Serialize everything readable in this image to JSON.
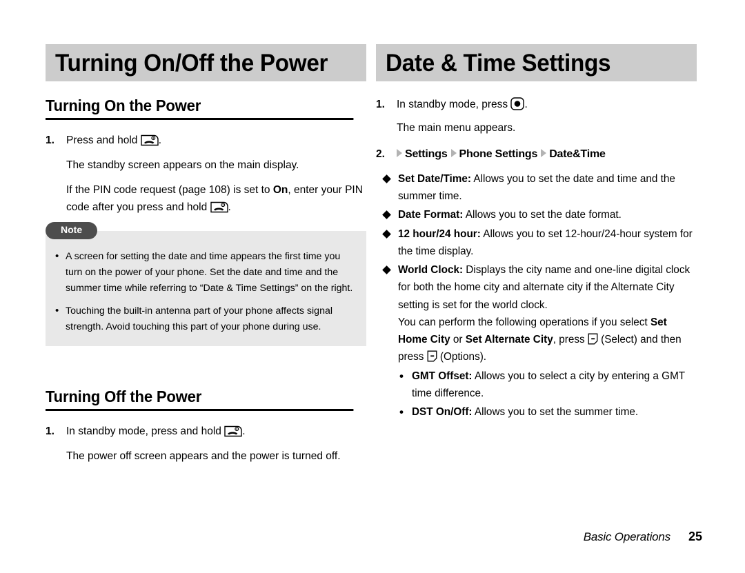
{
  "left": {
    "banner_title": "Turning On/Off the Power",
    "section1": {
      "heading": "Turning On the Power",
      "step1_num": "1.",
      "step1_text_before": "Press and hold",
      "step1_text_after": ".",
      "para1": "The standby screen appears on the main display.",
      "para2_a": "If the PIN code request (page 108) is set to ",
      "para2_bold": "On",
      "para2_b": ", enter your PIN code after you press and hold ",
      "para2_c": "."
    },
    "note": {
      "label": "Note",
      "items": [
        "A screen for setting the date and time appears the first time you turn on the power of your phone. Set the date and time and the summer time while referring to “Date & Time Settings” on the right.",
        "Touching the built-in antenna part of your phone affects signal strength. Avoid touching this part of your phone during use."
      ]
    },
    "section2": {
      "heading": "Turning Off the Power",
      "step1_num": "1.",
      "step1_text_before": "In standby mode, press and hold",
      "step1_text_after": ".",
      "para1": "The power off screen appears and the power is turned off."
    }
  },
  "right": {
    "banner_title": "Date & Time Settings",
    "step1_num": "1.",
    "step1_text_before": "In standby mode, press",
    "step1_text_after": ".",
    "step1_para": "The main menu appears.",
    "step2_num": "2.",
    "menu_path": [
      "Settings",
      "Phone Settings",
      "Date&Time"
    ],
    "features": [
      {
        "term": "Set Date/Time:",
        "desc": " Allows you to set the date and time and the summer time."
      },
      {
        "term": "Date Format:",
        "desc": " Allows you to set the date format."
      },
      {
        "term": "12 hour/24 hour:",
        "desc": " Allows you to set 12-hour/24-hour system for the time display."
      },
      {
        "term": "World Clock:",
        "desc": " Displays the city name and one-line digital clock for both the home city and alternate city if the Alternate City setting is set for the world clock."
      }
    ],
    "world_clock_extra": {
      "a": "You can perform the following operations if you select ",
      "bold1": "Set Home City",
      "b": " or ",
      "bold2": "Set Alternate City",
      "c": ", press ",
      "d": " (Select) and then press ",
      "e": " (Options)."
    },
    "sub_options": [
      {
        "term": "GMT Offset:",
        "desc": " Allows you to select a city by entering a GMT time difference."
      },
      {
        "term": "DST On/Off:",
        "desc": " Allows you to set the summer time."
      }
    ]
  },
  "footer": {
    "chapter": "Basic Operations",
    "page": "25"
  },
  "colors": {
    "banner_bg": "#cccccc",
    "note_bg": "#e8e8e8",
    "note_pill_bg": "#4d4d4d",
    "triangle": "#b3b3b3",
    "text": "#000000"
  },
  "icons": {
    "power_key": "phone-power-key-icon",
    "center_key": "center-select-key-icon",
    "soft_key": "left-soft-key-icon"
  }
}
